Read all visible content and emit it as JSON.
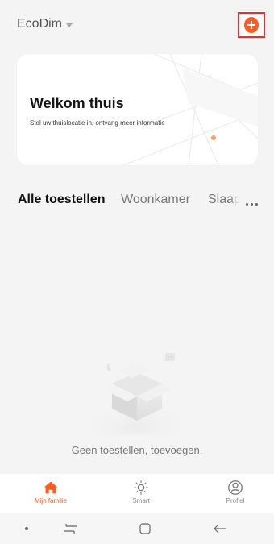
{
  "header": {
    "home_name": "EcoDim",
    "add_icon": "plus-circle-icon"
  },
  "welcome": {
    "title": "Welkom thuis",
    "subtitle": "Stel uw thuislocatie in, ontvang meer informatie"
  },
  "tabs": [
    {
      "label": "Alle toestellen",
      "active": true
    },
    {
      "label": "Woonkamer",
      "active": false
    },
    {
      "label": "Slaapkamer",
      "active": false
    }
  ],
  "more_icon": "more-horizontal-icon",
  "empty_state": {
    "icon": "empty-box-icon",
    "message": "Geen toestellen, toevoegen."
  },
  "bottom_nav": [
    {
      "label": "Mijn familie",
      "icon": "home-icon",
      "active": true
    },
    {
      "label": "Smart",
      "icon": "sun-icon",
      "active": false
    },
    {
      "label": "Profiel",
      "icon": "profile-icon",
      "active": false
    }
  ],
  "system_nav": {
    "dot_icon": "dot-icon",
    "recent_icon": "recent-apps-icon",
    "home_icon": "home-square-icon",
    "back_icon": "back-arrow-icon"
  },
  "colors": {
    "accent": "#ff5a1f",
    "highlight_box": "#e5312e",
    "background": "#f4f4f4"
  }
}
